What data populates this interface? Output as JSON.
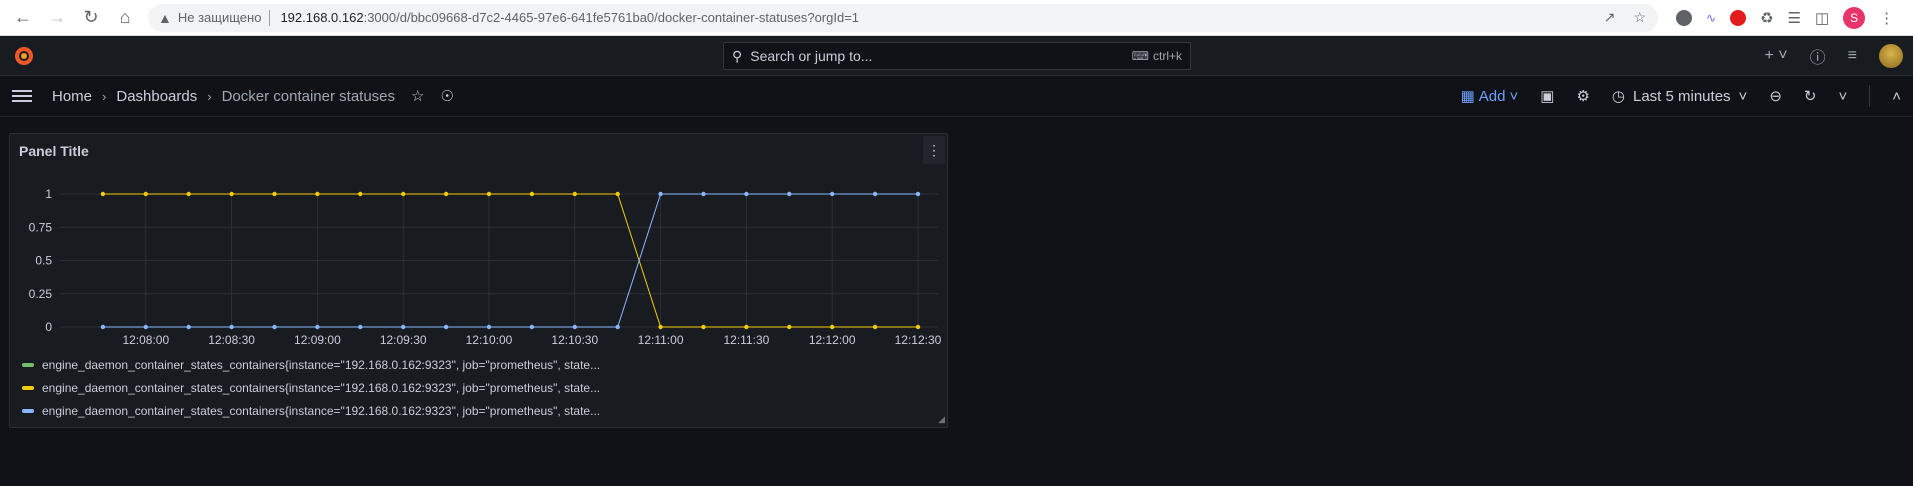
{
  "browser": {
    "security_label": "Не защищено",
    "url_host": "192.168.0.162",
    "url_path": ":3000/d/bbc09668-d7c2-4465-97e6-641fe5761ba0/docker-container-statuses?orgId=1",
    "profile_initial": "S"
  },
  "grafana": {
    "search_placeholder": "Search or jump to...",
    "search_shortcut": "ctrl+k"
  },
  "breadcrumb": {
    "home": "Home",
    "dashboards": "Dashboards",
    "current": "Docker container statuses"
  },
  "toolbar": {
    "add_label": "Add",
    "time_range": "Last 5 minutes",
    "accent": "#6e9fff"
  },
  "panel": {
    "title": "Panel Title"
  },
  "chart_data": {
    "type": "line",
    "title": "Panel Title",
    "x_ticks": [
      "12:08:00",
      "12:08:30",
      "12:09:00",
      "12:09:30",
      "12:10:00",
      "12:10:30",
      "12:11:00",
      "12:11:30",
      "12:12:00",
      "12:12:30"
    ],
    "y_ticks": [
      "0",
      "0.25",
      "0.5",
      "0.75",
      "1"
    ],
    "ylim": [
      0,
      1
    ],
    "x": [
      "12:07:45",
      "12:08:00",
      "12:08:15",
      "12:08:30",
      "12:08:45",
      "12:09:00",
      "12:09:15",
      "12:09:30",
      "12:09:45",
      "12:10:00",
      "12:10:15",
      "12:10:30",
      "12:10:45",
      "12:11:00",
      "12:11:15",
      "12:11:30",
      "12:11:45",
      "12:12:00",
      "12:12:15",
      "12:12:30"
    ],
    "series": [
      {
        "name": "engine_daemon_container_states_containers{instance=\"192.168.0.162:9323\", job=\"prometheus\", state...",
        "color": "#73bf69",
        "values": null
      },
      {
        "name": "engine_daemon_container_states_containers{instance=\"192.168.0.162:9323\", job=\"prometheus\", state...",
        "color": "#f2cc0c",
        "values": [
          1,
          1,
          1,
          1,
          1,
          1,
          1,
          1,
          1,
          1,
          1,
          1,
          1,
          0,
          0,
          0,
          0,
          0,
          0,
          0
        ]
      },
      {
        "name": "engine_daemon_container_states_containers{instance=\"192.168.0.162:9323\", job=\"prometheus\", state...",
        "color": "#8ab8ff",
        "values": [
          0,
          0,
          0,
          0,
          0,
          0,
          0,
          0,
          0,
          0,
          0,
          0,
          0,
          1,
          1,
          1,
          1,
          1,
          1,
          1
        ]
      }
    ],
    "grid": true
  }
}
